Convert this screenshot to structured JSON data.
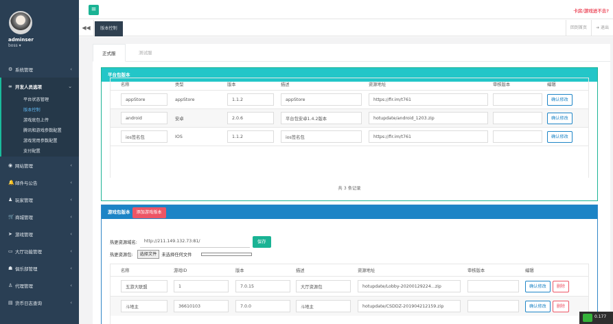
{
  "user": {
    "name": "adminser",
    "role": "boss ▾"
  },
  "menu": {
    "items": [
      {
        "label": "系统管理",
        "icon": "⚙"
      },
      {
        "label": "开发人员选项",
        "icon": "∞"
      },
      {
        "label": "网站管理",
        "icon": "◉"
      },
      {
        "label": "邮件与公告",
        "icon": "🔔"
      },
      {
        "label": "玩家管理",
        "icon": "♟"
      },
      {
        "label": "商城管理",
        "icon": "🛒"
      },
      {
        "label": "游戏管理",
        "icon": "➤"
      },
      {
        "label": "大厅功能管理",
        "icon": "▭"
      },
      {
        "label": "俱乐部管理",
        "icon": "☗"
      },
      {
        "label": "代理管理",
        "icon": "♙"
      },
      {
        "label": "货币日志查询",
        "icon": "▤"
      }
    ],
    "sub": [
      "平台状态管理",
      "版本控制",
      "游戏底包上传",
      "腾讯和游戏参数配置",
      "游戏常用参数配置",
      "支付配置"
    ],
    "chevron_closed": "‹",
    "chevron_open": "⌄"
  },
  "topbar": {
    "toggle": "≡",
    "notice": "卡房/游戏进不去?"
  },
  "tabs": {
    "nav": "◀◀",
    "active": "版本控制",
    "home": "回到首页",
    "logout": "➜ 退出"
  },
  "subtabs": {
    "formal": "正式服",
    "test": "测试服"
  },
  "platform": {
    "title": "平台包版本",
    "headers": [
      "名称",
      "类型",
      "版本",
      "描述",
      "资源地址",
      "审核版本",
      "编辑"
    ],
    "rows": [
      {
        "name": "appStore",
        "type": "appStore",
        "version": "1.1.2",
        "desc": "appStore",
        "url": "https://fir.im/t761",
        "audit": "",
        "btn": "确认修改"
      },
      {
        "name": "android",
        "type": "安卓",
        "version": "2.0.6",
        "desc": "平台包安卓1.4.2版本",
        "url": "hotupdate/android_1203.zip",
        "audit": "",
        "btn": "确认修改"
      },
      {
        "name": "ios签名包",
        "type": "IOS",
        "version": "1.1.2",
        "desc": "ios签名包",
        "url": "https://fir.im/t761",
        "audit": "",
        "btn": "确认修改"
      }
    ],
    "total": "共 3 条记录"
  },
  "game": {
    "title": "游戏包版本",
    "add": "添加游戏版本",
    "hot_label": "热更资源域名:",
    "hot_value": "http://211.149.132.73:81/",
    "save": "保存",
    "pkg_label": "热更资源包:",
    "file_btn": "选择文件",
    "file_text": "未选择任何文件",
    "headers": [
      "名称",
      "游戏ID",
      "版本",
      "描述",
      "资源地址",
      "审核版本",
      "编辑"
    ],
    "rows": [
      {
        "name": "五游大联盟",
        "id": "1",
        "version": "7.0.15",
        "desc": "大厅资源包",
        "url": "hotupdate/Lobby-20200129224...zip",
        "audit": "",
        "btn": "确认修改",
        "del": "删除"
      },
      {
        "name": "斗地主",
        "id": "36610103",
        "version": "7.0.0",
        "desc": "斗地主",
        "url": "hotupdate/CSDDZ-201904212159.zip",
        "audit": "",
        "btn": "确认修改",
        "del": "删除"
      }
    ]
  },
  "tray": {
    "text": "0.177"
  }
}
